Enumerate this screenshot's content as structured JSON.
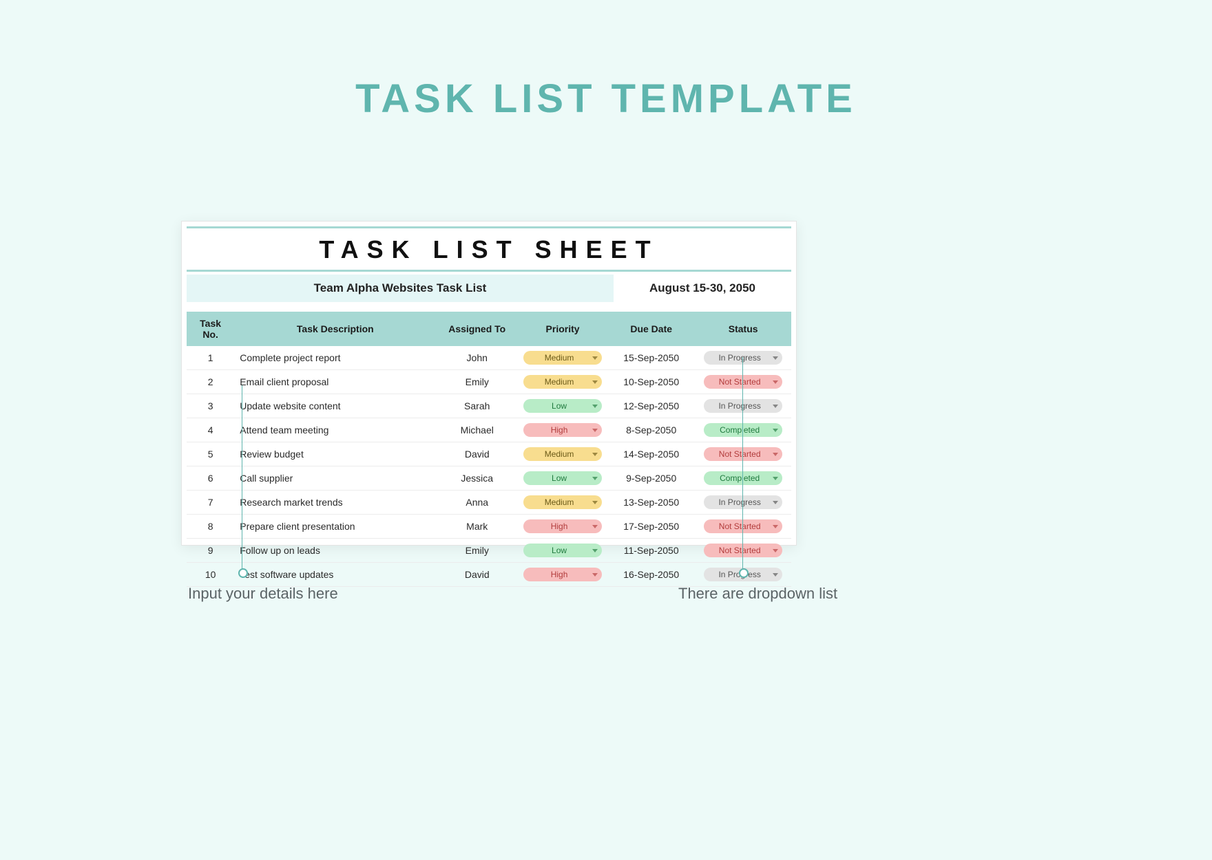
{
  "page": {
    "title": "TASK LIST TEMPLATE"
  },
  "sheet": {
    "title": "TASK LIST SHEET",
    "team": "Team Alpha Websites Task List",
    "date_range": "August 15-30, 2050",
    "headers": {
      "no": "Task No.",
      "desc": "Task Description",
      "assigned": "Assigned To",
      "priority": "Priority",
      "due": "Due Date",
      "status": "Status"
    },
    "rows": [
      {
        "no": "1",
        "desc": "Complete project report",
        "assigned": "John",
        "priority": "Medium",
        "due": "15-Sep-2050",
        "status": "In Progress"
      },
      {
        "no": "2",
        "desc": "Email client proposal",
        "assigned": "Emily",
        "priority": "Medium",
        "due": "10-Sep-2050",
        "status": "Not Started"
      },
      {
        "no": "3",
        "desc": "Update website content",
        "assigned": "Sarah",
        "priority": "Low",
        "due": "12-Sep-2050",
        "status": "In Progress"
      },
      {
        "no": "4",
        "desc": "Attend team meeting",
        "assigned": "Michael",
        "priority": "High",
        "due": "8-Sep-2050",
        "status": "Completed"
      },
      {
        "no": "5",
        "desc": "Review budget",
        "assigned": "David",
        "priority": "Medium",
        "due": "14-Sep-2050",
        "status": "Not Started"
      },
      {
        "no": "6",
        "desc": "Call supplier",
        "assigned": "Jessica",
        "priority": "Low",
        "due": "9-Sep-2050",
        "status": "Completed"
      },
      {
        "no": "7",
        "desc": "Research market trends",
        "assigned": "Anna",
        "priority": "Medium",
        "due": "13-Sep-2050",
        "status": "In Progress"
      },
      {
        "no": "8",
        "desc": "Prepare client presentation",
        "assigned": "Mark",
        "priority": "High",
        "due": "17-Sep-2050",
        "status": "Not Started"
      },
      {
        "no": "9",
        "desc": "Follow up on leads",
        "assigned": "Emily",
        "priority": "Low",
        "due": "11-Sep-2050",
        "status": "Not Started"
      },
      {
        "no": "10",
        "desc": "Test software updates",
        "assigned": "David",
        "priority": "High",
        "due": "16-Sep-2050",
        "status": "In Progress"
      }
    ]
  },
  "callouts": {
    "left": "Input your details here",
    "right": "There are dropdown list"
  },
  "colors": {
    "accent": "#5fb5ae",
    "header_bg": "#a6d8d3",
    "canvas": "#edfaf8",
    "priority": {
      "Medium": "#f8dd8f",
      "Low": "#b8ecc7",
      "High": "#f7bcbc"
    },
    "status": {
      "In Progress": "#e3e3e3",
      "Not Started": "#f7bcbc",
      "Completed": "#b8ecc7"
    }
  }
}
